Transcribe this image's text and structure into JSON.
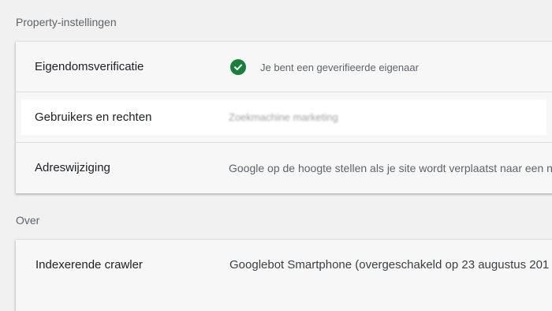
{
  "sections": {
    "property_settings_title": "Property-instellingen",
    "about_title": "Over"
  },
  "property_settings": {
    "ownership": {
      "label": "Eigendomsverificatie",
      "value": "Je bent een geverifieerde eigenaar",
      "icon": "check-circle-icon",
      "icon_color": "#188038"
    },
    "users": {
      "label": "Gebruikers en rechten",
      "value": "Zoekmachine marketing"
    },
    "address_change": {
      "label": "Adreswijziging",
      "value": "Google op de hoogte stellen als je site wordt verplaatst naar een n"
    }
  },
  "about": {
    "crawler": {
      "label": "Indexerende crawler",
      "value": "Googlebot Smartphone (overgeschakeld op 23 augustus 201"
    }
  }
}
